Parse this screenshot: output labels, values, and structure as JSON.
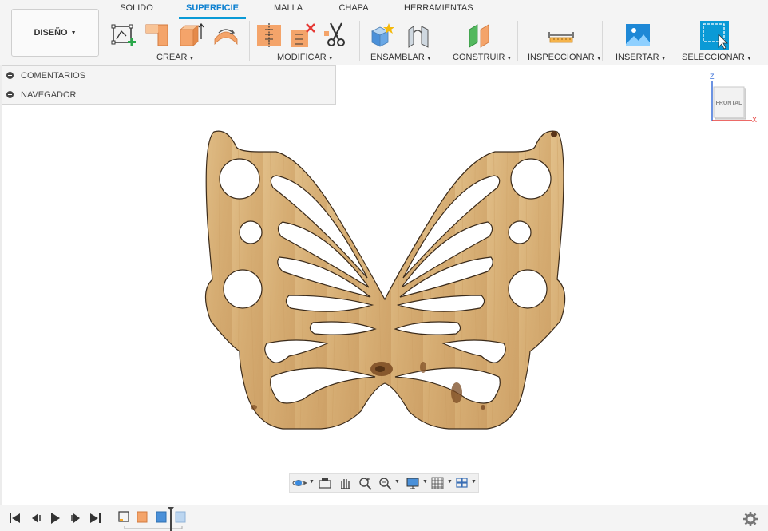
{
  "toolbar": {
    "design_label": "DISEÑO",
    "tabs": [
      {
        "label": "SOLIDO",
        "active": false
      },
      {
        "label": "SUPERFICIE",
        "active": true
      },
      {
        "label": "MALLA",
        "active": false
      },
      {
        "label": "CHAPA",
        "active": false
      },
      {
        "label": "HERRAMIENTAS",
        "active": false
      }
    ],
    "groups": {
      "crear": "CREAR",
      "modificar": "MODIFICAR",
      "ensamblar": "ENSAMBLAR",
      "construir": "CONSTRUIR",
      "inspeccionar": "INSPECCIONAR",
      "insertar": "INSERTAR",
      "seleccionar": "SELECCIONAR"
    }
  },
  "panels": {
    "comments": "COMENTARIOS",
    "navigator": "NAVEGADOR"
  },
  "viewcube": {
    "face_label": "FRONTAL",
    "axis_z": "Z",
    "axis_x": "X"
  },
  "colors": {
    "accent": "#0a9ad6",
    "wood": "#d9b47c"
  }
}
